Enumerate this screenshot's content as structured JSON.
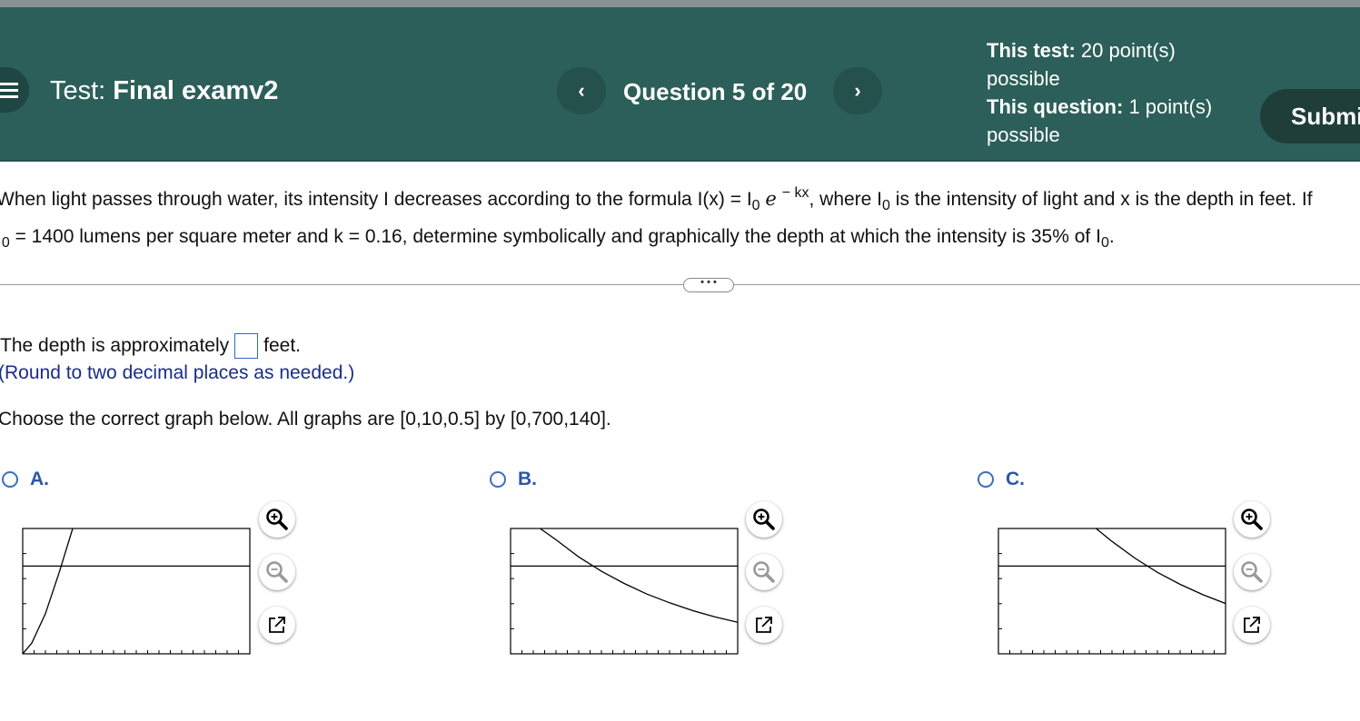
{
  "header": {
    "test_prefix": "Test:",
    "test_name": "Final examv2",
    "prev_symbol": "‹",
    "next_symbol": "›",
    "question_counter": "Question 5 of 20",
    "this_test_label": "This test:",
    "this_test_value": " 20 point(s) possible",
    "this_question_label": "This question:",
    "this_question_value": " 1 point(s) possible",
    "submit_label": "Submit test"
  },
  "question": {
    "line1_a": "When light passes through water, its intensity I decreases according to the formula I(x) = I",
    "sub0": "0",
    "e": "e",
    "exp": "− kx",
    "line1_b": ", where I",
    "line1_c": " is the intensity of light and x is the depth in feet. If",
    "line2_a": "I",
    "line2_b": " = 1400 lumens per square meter and k = 0.16, determine symbolically and graphically the depth at which the intensity is 35% of I",
    "line2_c": "."
  },
  "divider_dots": "• • •",
  "answer": {
    "prefix": "The depth is approximately",
    "value": "",
    "suffix": "feet.",
    "note": "(Round to two decimal places as needed.)"
  },
  "choose_text": "Choose the correct graph below. All graphs are [0,10,0.5] by [0,700,140].",
  "options": [
    {
      "label": "A.",
      "selected": false
    },
    {
      "label": "B.",
      "selected": false
    },
    {
      "label": "C.",
      "selected": false
    }
  ],
  "tools": [
    "zoom-in-icon",
    "zoom-out-icon",
    "open-external-icon"
  ],
  "colors": {
    "header_bg": "#2c5f59",
    "submit_bg": "#1f3e3a",
    "radio_border": "#3b6ec0",
    "option_label": "#2e56a8",
    "note_text": "#1b2d86"
  },
  "chart_data": [
    {
      "type": "line",
      "title": "",
      "xlim": [
        0,
        10
      ],
      "xscl": 0.5,
      "ylim": [
        0,
        700
      ],
      "yscl": 140,
      "series": [
        {
          "x": [
            0,
            0.4,
            1,
            1.6,
            2.2
          ],
          "y": [
            0,
            60,
            224,
            452,
            700
          ]
        },
        {
          "x": [
            0,
            10
          ],
          "y": [
            490,
            490
          ]
        }
      ]
    },
    {
      "type": "line",
      "title": "",
      "xlim": [
        0,
        10
      ],
      "xscl": 0.5,
      "ylim": [
        0,
        700
      ],
      "yscl": 140,
      "series": [
        {
          "x": [
            1.3,
            2,
            3,
            4,
            5,
            6,
            7,
            8,
            9,
            10
          ],
          "y": [
            700,
            637,
            541,
            461,
            393,
            334,
            285,
            242,
            206,
            176
          ]
        },
        {
          "x": [
            0,
            10
          ],
          "y": [
            490,
            490
          ]
        }
      ]
    },
    {
      "type": "line",
      "title": "",
      "xlim": [
        0,
        10
      ],
      "xscl": 0.5,
      "ylim": [
        0,
        700
      ],
      "yscl": 140,
      "series": [
        {
          "x": [
            4.3,
            5,
            6,
            7,
            8,
            9,
            10
          ],
          "y": [
            700,
            628,
            535,
            455,
            388,
            330,
            281
          ]
        },
        {
          "x": [
            0,
            10
          ],
          "y": [
            490,
            490
          ]
        }
      ]
    }
  ]
}
